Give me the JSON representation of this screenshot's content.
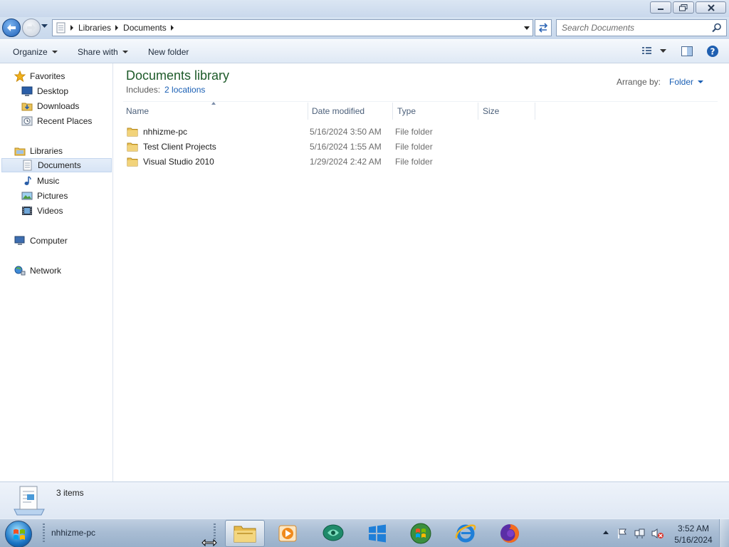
{
  "window": {
    "caption_buttons": [
      "minimize",
      "maximize",
      "close"
    ]
  },
  "address_bar": {
    "breadcrumbs": [
      "Libraries",
      "Documents"
    ],
    "search_placeholder": "Search Documents"
  },
  "command_bar": {
    "organize": "Organize",
    "share_with": "Share with",
    "new_folder": "New folder"
  },
  "nav_pane": {
    "favorites": {
      "label": "Favorites",
      "items": [
        {
          "label": "Desktop",
          "icon": "desktop-icon"
        },
        {
          "label": "Downloads",
          "icon": "downloads-icon"
        },
        {
          "label": "Recent Places",
          "icon": "recent-places-icon"
        }
      ]
    },
    "libraries": {
      "label": "Libraries",
      "items": [
        {
          "label": "Documents",
          "icon": "documents-icon",
          "selected": true
        },
        {
          "label": "Music",
          "icon": "music-icon"
        },
        {
          "label": "Pictures",
          "icon": "pictures-icon"
        },
        {
          "label": "Videos",
          "icon": "videos-icon"
        }
      ]
    },
    "computer": "Computer",
    "network": "Network"
  },
  "content": {
    "title": "Documents library",
    "includes_label": "Includes:",
    "includes_link": "2 locations",
    "arrange_label": "Arrange by:",
    "arrange_value": "Folder",
    "columns": [
      "Name",
      "Date modified",
      "Type",
      "Size"
    ],
    "files": [
      {
        "name": "nhhizme-pc",
        "date": "5/16/2024 3:50 AM",
        "type": "File folder",
        "size": ""
      },
      {
        "name": "Test Client Projects",
        "date": "5/16/2024 1:55 AM",
        "type": "File folder",
        "size": ""
      },
      {
        "name": "Visual Studio 2010",
        "date": "1/29/2024 2:42 AM",
        "type": "File folder",
        "size": ""
      }
    ]
  },
  "details_pane": {
    "item_count": "3 items"
  },
  "taskbar": {
    "toolbar_label": "nhhizme-pc",
    "pinned_apps": [
      "windows-explorer-icon",
      "media-player-icon",
      "chat-app-icon",
      "windows-logo-icon",
      "windows-orb-app-icon",
      "internet-explorer-icon",
      "firefox-icon"
    ],
    "clock_time": "3:52 AM",
    "clock_date": "5/16/2024"
  },
  "colors": {
    "library_title": "#1e5b2a",
    "link": "#1a5fb4",
    "selection": "#d7e4f5"
  }
}
